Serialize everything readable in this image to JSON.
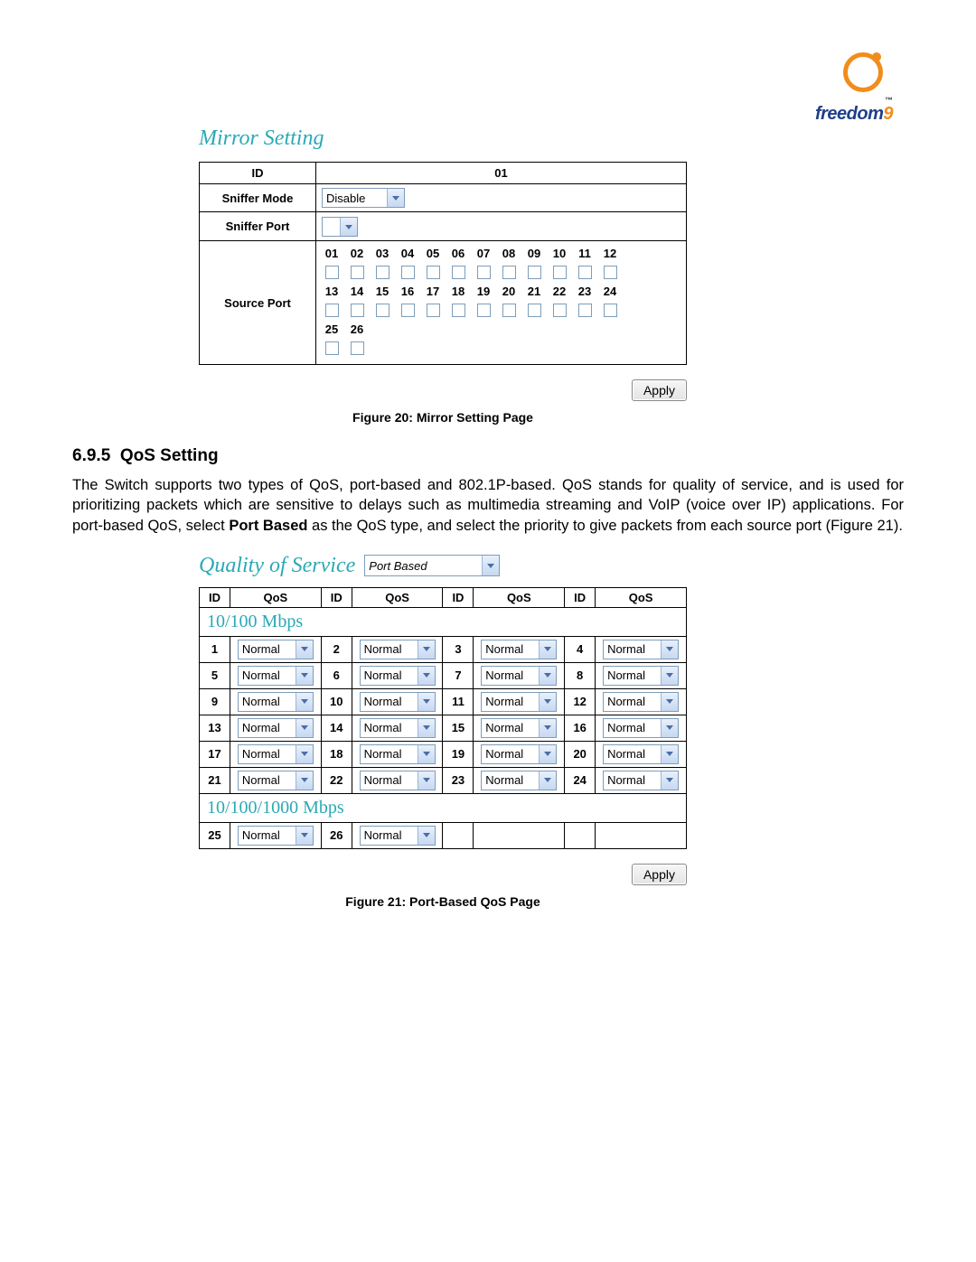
{
  "logo": {
    "brand": "freedom",
    "nine": "9"
  },
  "mirror": {
    "heading": "Mirror Setting",
    "id_label": "ID",
    "id_value": "01",
    "sniffer_mode_label": "Sniffer Mode",
    "sniffer_mode_value": "Disable",
    "sniffer_port_label": "Sniffer Port",
    "sniffer_port_value": "",
    "source_port_label": "Source Port",
    "ports_row1": [
      "01",
      "02",
      "03",
      "04",
      "05",
      "06",
      "07",
      "08",
      "09",
      "10",
      "11",
      "12"
    ],
    "ports_row2": [
      "13",
      "14",
      "15",
      "16",
      "17",
      "18",
      "19",
      "20",
      "21",
      "22",
      "23",
      "24"
    ],
    "ports_row3": [
      "25",
      "26"
    ],
    "apply_label": "Apply",
    "figcap": "Figure 20: Mirror Setting Page"
  },
  "section": {
    "number": "6.9.5",
    "title": "QoS Setting",
    "body_pre": "The Switch supports two types of QoS, port-based and 802.1P-based.  QoS stands for quality of service, and is used for prioritizing packets which are sensitive to delays such as multimedia streaming and VoIP (voice over IP) applications.  For port-based QoS, select ",
    "body_bold": "Port Based",
    "body_post": " as the QoS type, and select the priority to give packets from each source port (Figure 21)."
  },
  "qos": {
    "heading": "Quality of Service",
    "type_value": "Port Based",
    "col_id": "ID",
    "col_qos": "QoS",
    "sub1": "10/100 Mbps",
    "sub2": "10/100/1000 Mbps",
    "normal": "Normal",
    "ports_10_100": [
      1,
      2,
      3,
      4,
      5,
      6,
      7,
      8,
      9,
      10,
      11,
      12,
      13,
      14,
      15,
      16,
      17,
      18,
      19,
      20,
      21,
      22,
      23,
      24
    ],
    "ports_gig": [
      25,
      26
    ],
    "apply_label": "Apply",
    "figcap": "Figure 21: Port-Based QoS Page"
  }
}
